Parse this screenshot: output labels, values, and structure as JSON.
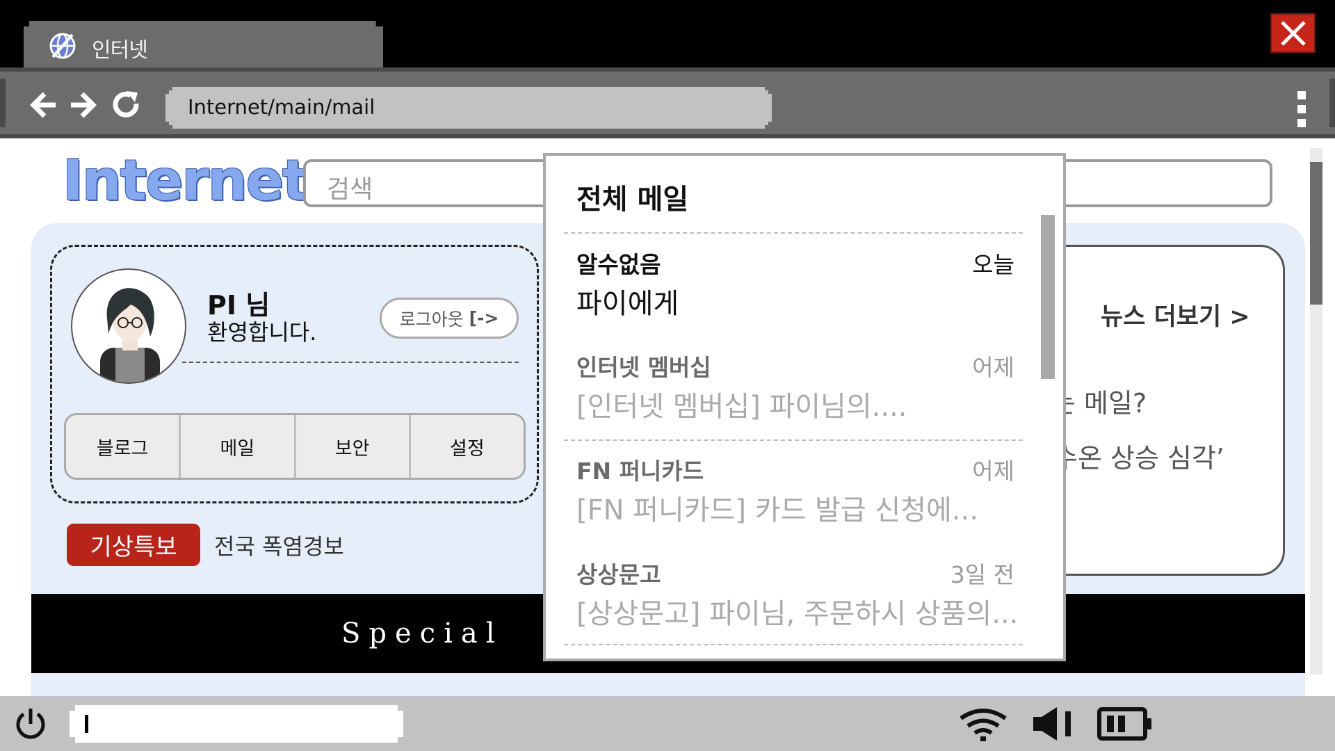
{
  "tab": {
    "title": "인터넷",
    "icon": "globe-icon"
  },
  "window": {
    "close_icon": "close-icon"
  },
  "nav": {
    "back_icon": "back-arrow-icon",
    "forward_icon": "forward-arrow-icon",
    "reload_icon": "reload-icon",
    "address": "Internet/main/mail",
    "menu_icon": "more-vertical-icon"
  },
  "header": {
    "logo": "Internet",
    "search_placeholder": "검색"
  },
  "profile": {
    "name": "PI 님",
    "welcome": "환영합니다.",
    "logout_label": "로그아웃",
    "logout_icon": "[->",
    "menu": [
      "블로그",
      "메일",
      "보안",
      "설정"
    ]
  },
  "weather": {
    "badge": "기상특보",
    "text": "전국 폭염경보"
  },
  "news": {
    "more_label": "뉴스 더보기 >",
    "line1": "는 메일?",
    "line2": "수온 상승 심각’"
  },
  "special": {
    "label": "Special"
  },
  "mail_popup": {
    "title": "전체 메일",
    "items": [
      {
        "from": "알수없음",
        "date": "오늘",
        "subject": "파이에게",
        "read": false
      },
      {
        "from": "인터넷 멤버십",
        "date": "어제",
        "subject": "[인터넷 멤버십] 파이님의....",
        "read": true
      },
      {
        "from": "FN 퍼니카드",
        "date": "어제",
        "subject": "[FN 퍼니카드] 카드 발급 신청에...",
        "read": true
      },
      {
        "from": "상상문고",
        "date": "3일 전",
        "subject": "[상상문고] 파이님, 주문하시 상품의...",
        "read": true
      }
    ]
  },
  "taskbar": {
    "power_icon": "power-icon",
    "wifi_icon": "wifi-icon",
    "volume_icon": "volume-icon",
    "battery_icon": "battery-icon"
  },
  "colors": {
    "accent_red": "#c52619",
    "logo_blue": "#86a8ef",
    "panel_bg": "#e6eefa",
    "chrome_gray": "#6c6c6c"
  }
}
